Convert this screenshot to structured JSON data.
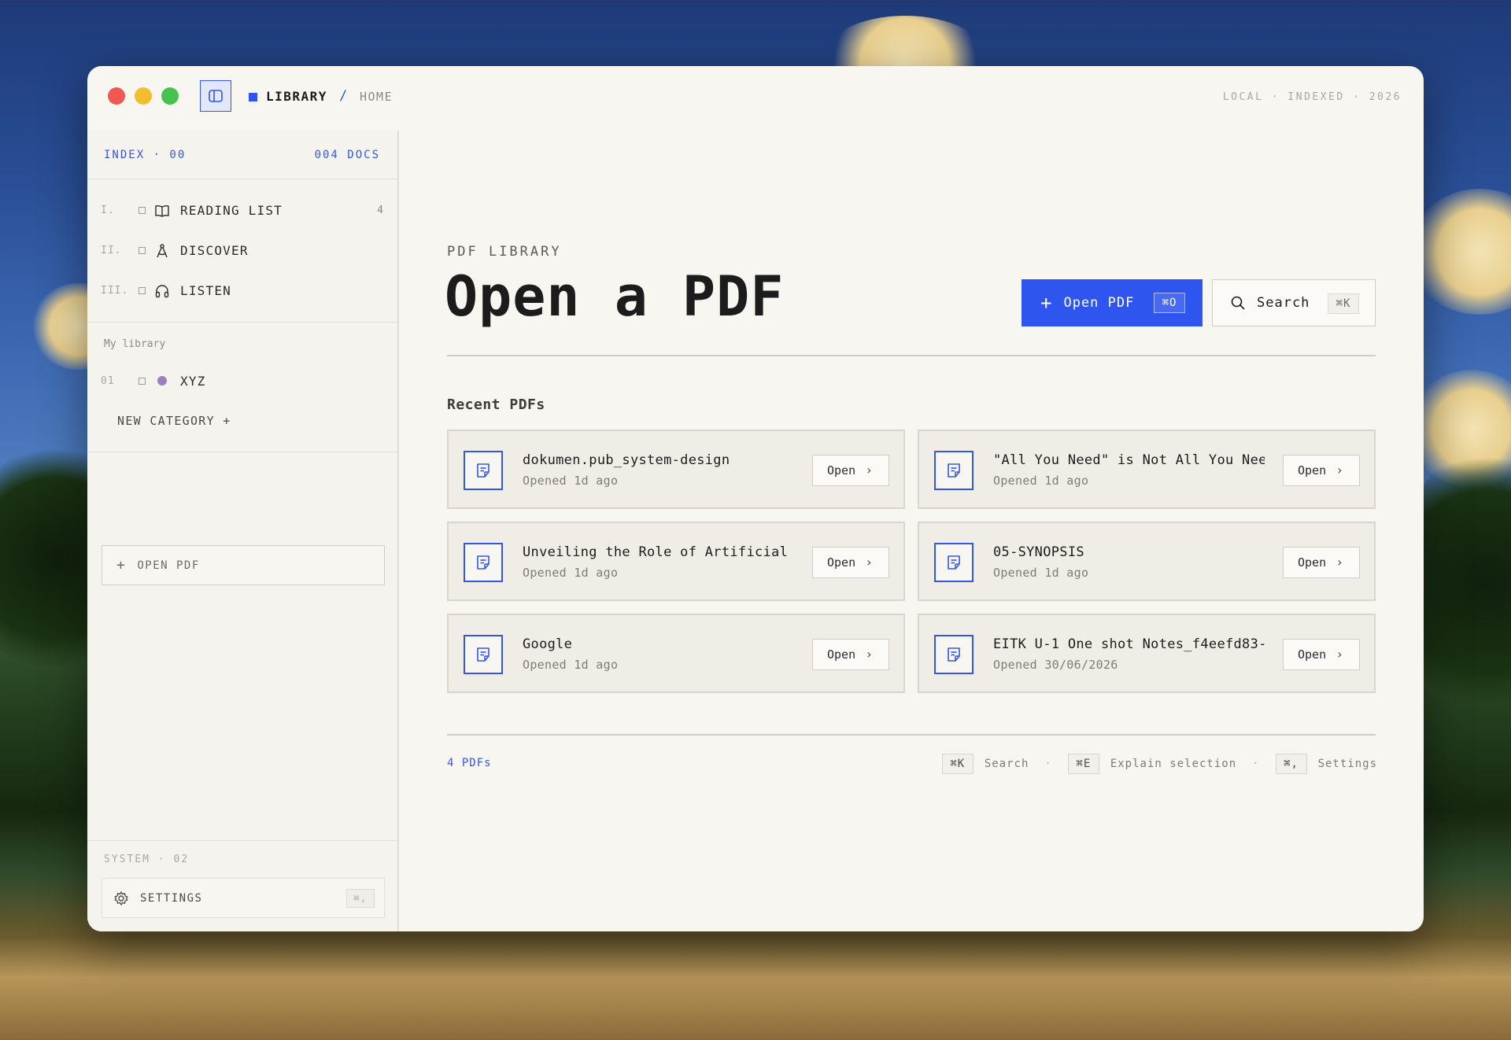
{
  "titlebar": {
    "breadcrumb_root": "LIBRARY",
    "breadcrumb_sep": "/",
    "breadcrumb_current": "HOME",
    "status": "LOCAL · INDEXED · 2026"
  },
  "sidebar": {
    "index_label": "INDEX · 00",
    "docs_count": "004 DOCS",
    "nav": [
      {
        "num": "I.",
        "label": "READING LIST",
        "count": "4",
        "icon": "book-open-icon"
      },
      {
        "num": "II.",
        "label": "DISCOVER",
        "count": "",
        "icon": "compass-drafting-icon"
      },
      {
        "num": "III.",
        "label": "LISTEN",
        "count": "",
        "icon": "headphones-icon"
      }
    ],
    "library_heading": "My library",
    "library_items": [
      {
        "num": "01",
        "label": "XYZ",
        "color": "#9a7fc4"
      }
    ],
    "new_category": "NEW CATEGORY +",
    "open_pdf": "OPEN PDF",
    "system_label": "SYSTEM · 02",
    "settings_label": "SETTINGS",
    "settings_shortcut": "⌘,"
  },
  "main": {
    "eyebrow": "PDF LIBRARY",
    "title": "Open a PDF",
    "open_pdf_label": "Open PDF",
    "open_pdf_shortcut": "⌘O",
    "search_label": "Search",
    "search_shortcut": "⌘K",
    "recent_heading": "Recent PDFs",
    "recent": [
      {
        "title": "dokumen.pub_system-design",
        "opened": "Opened 1d ago",
        "action": "Open"
      },
      {
        "title": "\"All You Need\" is Not All You Nee…",
        "opened": "Opened 1d ago",
        "action": "Open"
      },
      {
        "title": "Unveiling the Role of Artificial …",
        "opened": "Opened 1d ago",
        "action": "Open"
      },
      {
        "title": "05-SYNOPSIS",
        "opened": "Opened 1d ago",
        "action": "Open"
      },
      {
        "title": "Google",
        "opened": "Opened 1d ago",
        "action": "Open"
      },
      {
        "title": "EITK U-1 One shot Notes_f4eefd83-…",
        "opened": "Opened 30/06/2026",
        "action": "Open"
      }
    ],
    "footer_count": "4 PDFs",
    "shortcuts": [
      {
        "key": "⌘K",
        "label": "Search"
      },
      {
        "key": "⌘E",
        "label": "Explain selection"
      },
      {
        "key": "⌘,",
        "label": "Settings"
      }
    ]
  },
  "colors": {
    "accent": "#2f55ef",
    "background": "#f7f6f1",
    "category_xyz": "#9a7fc4"
  }
}
